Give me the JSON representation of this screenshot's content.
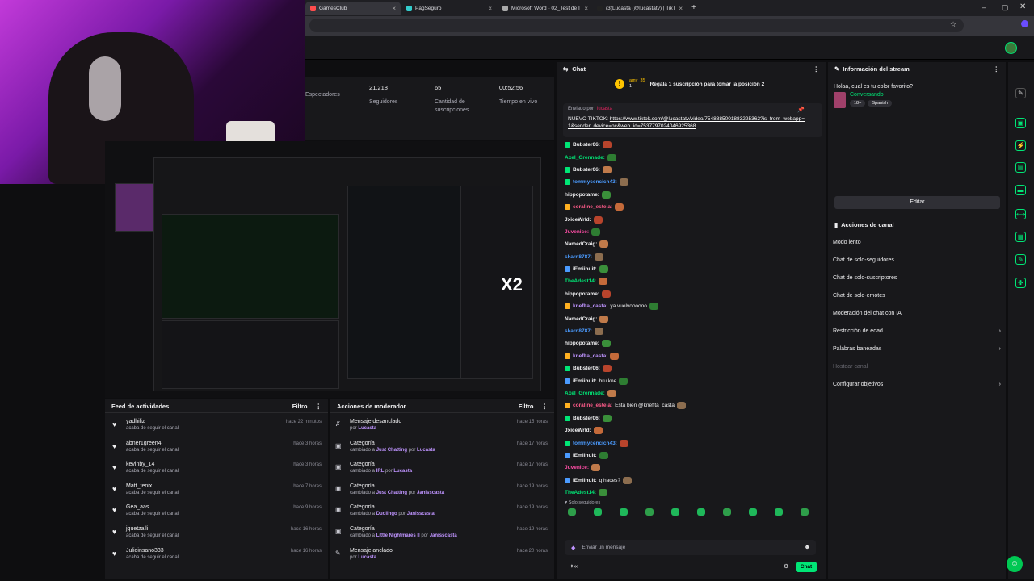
{
  "browser": {
    "tabs": [
      {
        "label": "GamesClub",
        "color": "#ff4d4d"
      },
      {
        "label": "PagSeguro",
        "color": "#3cc"
      },
      {
        "label": "Microsoft Word - 02_Test de I...",
        "color": "#aaa"
      },
      {
        "label": "(3)Lucasta (@lucastatv) | TikTok",
        "color": "#222"
      }
    ],
    "new_tab": "+"
  },
  "stats": [
    {
      "value": "",
      "label": "Espectadores"
    },
    {
      "value": "21.218",
      "label": "Seguidores"
    },
    {
      "value": "65",
      "label": "Cantidad de suscripciones"
    },
    {
      "value": "00:52:56",
      "label": "Tiempo en vivo"
    }
  ],
  "feed": {
    "title": "Feed de actividades",
    "filter": "Filtro",
    "items": [
      {
        "name": "yadhiliz",
        "sub": "acaba de seguir el canal",
        "time": "hace 22 minutos"
      },
      {
        "name": "abner1green4",
        "sub": "acaba de seguir el canal",
        "time": "hace 3 horas"
      },
      {
        "name": "kevinby_14",
        "sub": "acaba de seguir el canal",
        "time": "hace 3 horas"
      },
      {
        "name": "Matt_fenix",
        "sub": "acaba de seguir el canal",
        "time": "hace 7 horas"
      },
      {
        "name": "Gea_aas",
        "sub": "acaba de seguir el canal",
        "time": "hace 9 horas"
      },
      {
        "name": "jquetzalli",
        "sub": "acaba de seguir el canal",
        "time": "hace 16 horas"
      },
      {
        "name": "Julioinsano333",
        "sub": "acaba de seguir el canal",
        "time": "hace 16 horas"
      }
    ]
  },
  "mod": {
    "title": "Acciones de moderador",
    "filter": "Filtro",
    "items": [
      {
        "icon": "✗",
        "title": "Mensaje desanclado",
        "a": "por ",
        "b": "Lucasta",
        "c": "",
        "d": "",
        "time": "hace 15 horas"
      },
      {
        "icon": "▣",
        "title": "Categoría",
        "a": "cambiado a ",
        "b": "Just Chatting",
        "c": " por ",
        "d": "Lucasta",
        "time": "hace 17 horas"
      },
      {
        "icon": "▣",
        "title": "Categoría",
        "a": "cambiado a ",
        "b": "IRL",
        "c": " por ",
        "d": "Lucasta",
        "time": "hace 17 horas"
      },
      {
        "icon": "▣",
        "title": "Categoría",
        "a": "cambiado a ",
        "b": "Just Chatting",
        "c": " por ",
        "d": "Janisscasta",
        "time": "hace 19 horas"
      },
      {
        "icon": "▣",
        "title": "Categoría",
        "a": "cambiado a ",
        "b": "Duolingo",
        "c": " por ",
        "d": "Janisscasta",
        "time": "hace 19 horas"
      },
      {
        "icon": "▣",
        "title": "Categoría",
        "a": "cambiado a ",
        "b": "Little Nightmares II",
        "c": " por ",
        "d": "Janisscasta",
        "time": "hace 19 horas"
      },
      {
        "icon": "✎",
        "title": "Mensaje anclado",
        "a": "por ",
        "b": "Lucasta",
        "c": "",
        "d": "",
        "time": "hace 20 horas"
      }
    ]
  },
  "chat": {
    "title": "Chat",
    "hype_user": "amy_35",
    "hype_count": "1",
    "hype_text": "Regala 1 suscripción para tomar la posición 2",
    "pinned_by": "Enviado por",
    "pinned_user": "lucasta",
    "pinned_text": "NUEVO TIKTOK: ",
    "pinned_link": "https://www.tiktok.com/@lucastatv/video/7548885001883225362?is_from_webapp=1&sender_device=pc&web_id=7537797024046925368",
    "messages": [
      {
        "user": "Bubster06:",
        "color": "#efeff1",
        "text": "",
        "b": "#00e676"
      },
      {
        "user": "Axel_Grennade:",
        "color": "#00e676",
        "text": "",
        "b": ""
      },
      {
        "user": "Bubster06:",
        "color": "#efeff1",
        "text": "",
        "b": "#00e676"
      },
      {
        "user": "tommycencich43:",
        "color": "#4b9bff",
        "text": "",
        "b": "#00e676"
      },
      {
        "user": "hippopotame:",
        "color": "#efeff1",
        "text": "",
        "b": ""
      },
      {
        "user": "coraline_estela:",
        "color": "#ff5b8a",
        "text": "",
        "b": "#ffb020"
      },
      {
        "user": "JxiceWrld:",
        "color": "#efeff1",
        "text": "",
        "b": ""
      },
      {
        "user": "Juvenice:",
        "color": "#ff4da6",
        "text": "",
        "b": ""
      },
      {
        "user": "NamedCraig:",
        "color": "#efeff1",
        "text": "",
        "b": ""
      },
      {
        "user": "skarn8787:",
        "color": "#4b9bff",
        "text": "",
        "b": ""
      },
      {
        "user": "iEmiinuit:",
        "color": "#efeff1",
        "text": "",
        "b": "#4b9bff"
      },
      {
        "user": "TheAdest14:",
        "color": "#00e676",
        "text": "",
        "b": ""
      },
      {
        "user": "hippopotame:",
        "color": "#efeff1",
        "text": "",
        "b": ""
      },
      {
        "user": "kneflta_casta:",
        "color": "#bf94ff",
        "text": "ya vuelvoooooo",
        "b": "#ffb020"
      },
      {
        "user": "NamedCraig:",
        "color": "#efeff1",
        "text": "",
        "b": ""
      },
      {
        "user": "skarn8787:",
        "color": "#4b9bff",
        "text": "",
        "b": ""
      },
      {
        "user": "hippopotame:",
        "color": "#efeff1",
        "text": "",
        "b": ""
      },
      {
        "user": "kneflta_casta:",
        "color": "#bf94ff",
        "text": "",
        "b": "#ffb020"
      },
      {
        "user": "Bubster06:",
        "color": "#efeff1",
        "text": "",
        "b": "#00e676"
      },
      {
        "user": "iEmiinuit:",
        "color": "#efeff1",
        "text": "bru kne",
        "b": "#4b9bff"
      },
      {
        "user": "Axel_Grennade:",
        "color": "#00e676",
        "text": "",
        "b": ""
      },
      {
        "user": "coraline_estela:",
        "color": "#ff5b8a",
        "text": "Esta bien @kneflta_casta",
        "b": "#ffb020"
      },
      {
        "user": "Bubster06:",
        "color": "#efeff1",
        "text": "",
        "b": "#00e676"
      },
      {
        "user": "JxiceWrld:",
        "color": "#efeff1",
        "text": "",
        "b": ""
      },
      {
        "user": "tommycencich43:",
        "color": "#4b9bff",
        "text": "",
        "b": "#00e676"
      },
      {
        "user": "iEmiinuit:",
        "color": "#efeff1",
        "text": "",
        "b": "#4b9bff"
      },
      {
        "user": "Juvenice:",
        "color": "#ff4da6",
        "text": "",
        "b": ""
      },
      {
        "user": "iEmiinuit:",
        "color": "#efeff1",
        "text": "q haces?",
        "b": "#4b9bff"
      },
      {
        "user": "TheAdest14:",
        "color": "#00e676",
        "text": "",
        "b": ""
      }
    ],
    "followers_only": "Solo seguidores",
    "input_placeholder": "Enviar un mensaje",
    "send": "Chat"
  },
  "info": {
    "title": "Información del stream",
    "stream_title": "Holaa, cual es tu color favorito?",
    "category": "Conversando",
    "tags": [
      "18+",
      "Spanish"
    ],
    "edit": "Editar"
  },
  "modactions": {
    "title": "Acciones de canal",
    "options": [
      {
        "label": "Modo lento",
        "arrow": ""
      },
      {
        "label": "Chat de solo-seguidores",
        "arrow": ""
      },
      {
        "label": "Chat de solo-suscriptores",
        "arrow": ""
      },
      {
        "label": "Chat de solo-emotes",
        "arrow": ""
      },
      {
        "label": "Moderación del chat con IA",
        "arrow": ""
      },
      {
        "label": "Restricción de edad",
        "arrow": "›"
      },
      {
        "label": "Palabras baneadas",
        "arrow": "›"
      },
      {
        "label": "Hostear canal",
        "arrow": ""
      },
      {
        "label": "Configurar objetivos",
        "arrow": "›"
      }
    ]
  },
  "overlay_text": "X2"
}
